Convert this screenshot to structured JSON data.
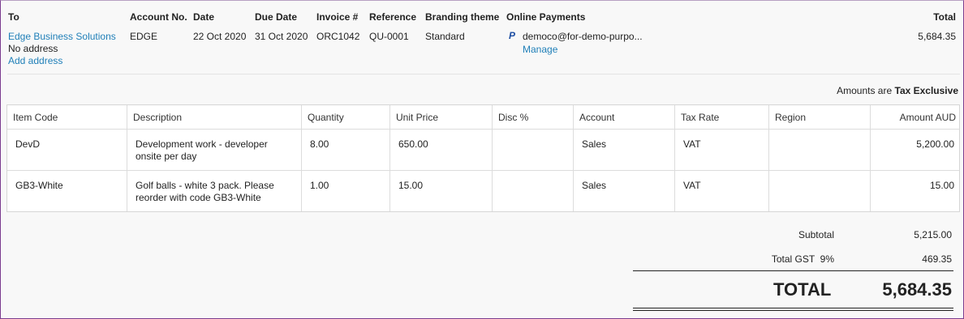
{
  "header": {
    "to": "To",
    "account_no": "Account No.",
    "date": "Date",
    "due_date": "Due Date",
    "invoice": "Invoice #",
    "reference": "Reference",
    "branding": "Branding theme",
    "online_payments": "Online Payments",
    "total": "Total"
  },
  "invoice": {
    "contact": "Edge Business Solutions",
    "address": "No address",
    "add_address": "Add address",
    "account_no": "EDGE",
    "date": "22 Oct 2020",
    "due_date": "31 Oct 2020",
    "invoice_no": "ORC1042",
    "reference": "QU-0001",
    "branding": "Standard",
    "payment_icon": "paypal-icon",
    "payment_email": "democo@for-demo-purpo...",
    "manage": "Manage",
    "total": "5,684.35"
  },
  "tax_note": {
    "prefix": "Amounts are",
    "mode": "Tax Exclusive"
  },
  "table": {
    "columns": [
      "Item Code",
      "Description",
      "Quantity",
      "Unit Price",
      "Disc %",
      "Account",
      "Tax Rate",
      "Region",
      "Amount AUD"
    ],
    "rows": [
      {
        "item_code": "DevD",
        "description_1": "Development work - developer",
        "description_2": "onsite per day",
        "quantity": "8.00",
        "unit_price": "650.00",
        "disc": "",
        "account": "Sales",
        "tax_rate": "VAT",
        "region": "",
        "amount": "5,200.00"
      },
      {
        "item_code": "GB3-White",
        "description_1": "Golf balls - white 3 pack. Please",
        "description_2": "reorder with code GB3-White",
        "quantity": "1.00",
        "unit_price": "15.00",
        "disc": "",
        "account": "Sales",
        "tax_rate": "VAT",
        "region": "",
        "amount": "15.00"
      }
    ]
  },
  "summary": {
    "subtotal_label": "Subtotal",
    "subtotal": "5,215.00",
    "gst_label": "Total GST  9%",
    "gst": "469.35",
    "total_label": "TOTAL",
    "total": "5,684.35"
  },
  "colors": {
    "link": "#1f7fb8",
    "frame": "#7a3d8f"
  }
}
